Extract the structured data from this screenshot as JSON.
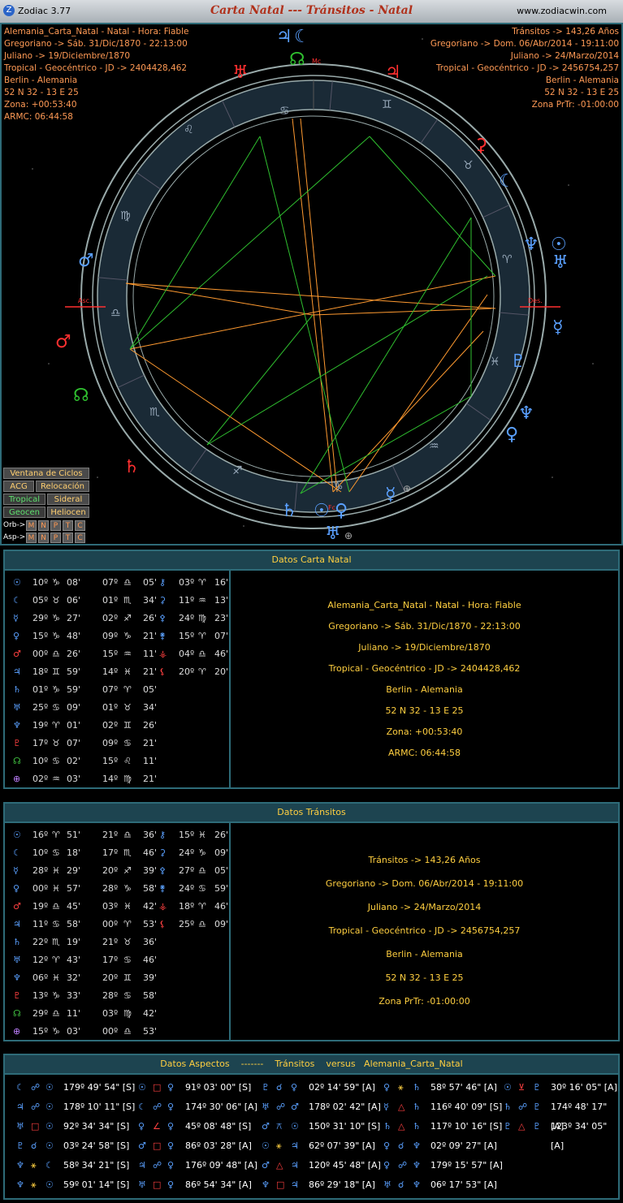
{
  "titlebar": {
    "app": "Zodiac 3.77",
    "title": "Carta Natal --- Tránsitos - Natal",
    "web": "www.zodiacwin.com"
  },
  "natal_info": [
    "Alemania_Carta_Natal - Natal - Hora: Fiable",
    "Gregoriano -> Sáb. 31/Dic/1870 - 22:13:00",
    "Juliano -> 19/Diciembre/1870",
    "Tropical - Geocéntrico - JD -> 2404428,462",
    "Berlin - Alemania",
    "52 N 32 - 13 E 25",
    "Zona: +00:53:40",
    "ARMC: 06:44:58"
  ],
  "transit_info": [
    "Tránsitos -> 143,26 Años",
    "Gregoriano -> Dom. 06/Abr/2014 - 19:11:00",
    "Juliano -> 24/Marzo/2014",
    "Tropical - Geocéntrico - JD -> 2456754,257",
    "Berlin - Alemania",
    "52 N 32 - 13 E 25",
    "Zona PrTr: -01:00:00"
  ],
  "wheel_labels": {
    "asc": "Asc.",
    "des": "Des.",
    "mc": "Mc",
    "fc": "Fc"
  },
  "buttons": {
    "ciclos": "Ventana de Ciclos",
    "acg": "ACG",
    "relocacion": "Relocación",
    "tropical": "Tropical",
    "sideral": "Sideral",
    "geocen": "Geocen",
    "heliocen": "Heliocen",
    "orb": "Orb->",
    "asp": "Asp->",
    "letters": [
      "M",
      "N",
      "P",
      "T",
      "C"
    ]
  },
  "natal_panel": {
    "header": "Datos Carta Natal",
    "rows": [
      [
        "☉",
        "10º",
        "♑",
        "08'",
        "07º",
        "♎",
        "05'",
        "⚷",
        "03º",
        "♈",
        "16'"
      ],
      [
        "☾",
        "05º",
        "♉",
        "06'",
        "01º",
        "♏",
        "34'",
        "⚳",
        "11º",
        "♒",
        "13'"
      ],
      [
        "☿",
        "29º",
        "♑",
        "27'",
        "02º",
        "♐",
        "26'",
        "⚴",
        "24º",
        "♍",
        "23'"
      ],
      [
        "♀",
        "15º",
        "♑",
        "48'",
        "09º",
        "♑",
        "21'",
        "⚵",
        "15º",
        "♈",
        "07'"
      ],
      [
        "♂",
        "00º",
        "♎",
        "26'",
        "15º",
        "♒",
        "11'",
        "⚶",
        "04º",
        "♎",
        "46'"
      ],
      [
        "♃",
        "18º",
        "♊",
        "59'",
        "14º",
        "♓",
        "21'",
        "⚸",
        "20º",
        "♈",
        "20'"
      ],
      [
        "♄",
        "01º",
        "♑",
        "59'",
        "07º",
        "♈",
        "05'",
        "",
        "",
        "",
        ""
      ],
      [
        "♅",
        "25º",
        "♋",
        "09'",
        "01º",
        "♉",
        "34'",
        "",
        "",
        "",
        ""
      ],
      [
        "♆",
        "19º",
        "♈",
        "01'",
        "02º",
        "♊",
        "26'",
        "",
        "",
        "",
        ""
      ],
      [
        "♇",
        "17º",
        "♉",
        "07'",
        "09º",
        "♋",
        "21'",
        "",
        "",
        "",
        ""
      ],
      [
        "☊",
        "10º",
        "♋",
        "02'",
        "15º",
        "♌",
        "11'",
        "",
        "",
        "",
        ""
      ],
      [
        "⊕",
        "02º",
        "♒",
        "03'",
        "14º",
        "♍",
        "21'",
        "",
        "",
        "",
        ""
      ]
    ],
    "info": [
      "Alemania_Carta_Natal - Natal - Hora: Fiable",
      "Gregoriano -> Sáb. 31/Dic/1870 - 22:13:00",
      "Juliano -> 19/Diciembre/1870",
      "Tropical - Geocéntrico - JD -> 2404428,462",
      "Berlin - Alemania",
      "52 N 32 - 13 E 25",
      "Zona: +00:53:40",
      "ARMC: 06:44:58"
    ]
  },
  "transit_panel": {
    "header": "Datos Tránsitos",
    "rows": [
      [
        "☉",
        "16º",
        "♈",
        "51'",
        "21º",
        "♎",
        "36'",
        "⚷",
        "15º",
        "♓",
        "26'"
      ],
      [
        "☾",
        "10º",
        "♋",
        "18'",
        "17º",
        "♏",
        "46'",
        "⚳",
        "24º",
        "♑",
        "09'"
      ],
      [
        "☿",
        "28º",
        "♓",
        "29'",
        "20º",
        "♐",
        "39'",
        "⚴",
        "27º",
        "♎",
        "05'"
      ],
      [
        "♀",
        "00º",
        "♓",
        "57'",
        "28º",
        "♑",
        "58'",
        "⚵",
        "24º",
        "♋",
        "59'"
      ],
      [
        "♂",
        "19º",
        "♎",
        "45'",
        "03º",
        "♓",
        "42'",
        "⚶",
        "18º",
        "♈",
        "46'"
      ],
      [
        "♃",
        "11º",
        "♋",
        "58'",
        "00º",
        "♈",
        "53'",
        "⚸",
        "25º",
        "♎",
        "09'"
      ],
      [
        "♄",
        "22º",
        "♏",
        "19'",
        "21º",
        "♉",
        "36'",
        "",
        "",
        "",
        ""
      ],
      [
        "♅",
        "12º",
        "♈",
        "43'",
        "17º",
        "♋",
        "46'",
        "",
        "",
        "",
        ""
      ],
      [
        "♆",
        "06º",
        "♓",
        "32'",
        "20º",
        "♊",
        "39'",
        "",
        "",
        "",
        ""
      ],
      [
        "♇",
        "13º",
        "♑",
        "33'",
        "28º",
        "♋",
        "58'",
        "",
        "",
        "",
        ""
      ],
      [
        "☊",
        "29º",
        "♎",
        "11'",
        "03º",
        "♍",
        "42'",
        "",
        "",
        "",
        ""
      ],
      [
        "⊕",
        "15º",
        "♑",
        "03'",
        "00º",
        "♎",
        "53'",
        "",
        "",
        "",
        ""
      ]
    ],
    "info": [
      "Tránsitos -> 143,26 Años",
      "Gregoriano -> Dom. 06/Abr/2014 - 19:11:00",
      "Juliano -> 24/Marzo/2014",
      "Tropical - Geocéntrico - JD -> 2456754,257",
      "Berlin - Alemania",
      "52 N 32 - 13 E 25",
      "Zona PrTr: -01:00:00"
    ]
  },
  "aspect_panel": {
    "header": [
      "Datos Aspectos",
      "-------",
      "Tránsitos",
      "versus",
      "Alemania_Carta_Natal"
    ],
    "cols": [
      [
        [
          "☾",
          "☍",
          "☉",
          "179º 49' 54\" [S]"
        ],
        [
          "♃",
          "☍",
          "☉",
          "178º 10' 11\" [S]"
        ],
        [
          "♅",
          "□",
          "☉",
          "92º 34' 34\" [S]"
        ],
        [
          "♇",
          "☌",
          "☉",
          "03º 24' 58\" [S]"
        ],
        [
          "♆",
          "⚹",
          "☾",
          "58º 34' 21\" [S]"
        ],
        [
          "♆",
          "⚹",
          "☉",
          "59º 01' 14\" [S]"
        ]
      ],
      [
        [
          "☉",
          "□",
          "♀",
          "91º 03' 00\" [S]"
        ],
        [
          "☾",
          "☍",
          "♀",
          "174º 30' 06\" [A]"
        ],
        [
          "♀",
          "∠",
          "♀",
          "45º 08' 48\" [S]"
        ],
        [
          "♂",
          "□",
          "♀",
          "86º 03' 28\" [A]"
        ],
        [
          "♃",
          "☍",
          "♀",
          "176º 09' 48\" [A]"
        ],
        [
          "♅",
          "□",
          "♀",
          "86º 54' 34\" [A]"
        ]
      ],
      [
        [
          "♇",
          "☌",
          "♀",
          "02º 14' 59\" [A]"
        ],
        [
          "♅",
          "☍",
          "♂",
          "178º 02' 42\" [A]"
        ],
        [
          "♂",
          "⚻",
          "☉",
          "150º 31' 10\" [S]"
        ],
        [
          "☉",
          "⚹",
          "♃",
          "62º 07' 39\" [A]"
        ],
        [
          "♂",
          "△",
          "♃",
          "120º 45' 48\" [A]"
        ],
        [
          "♆",
          "□",
          "♃",
          "86º 29' 18\" [A]"
        ]
      ],
      [
        [
          "♀",
          "⚹",
          "♄",
          "58º 57' 46\" [A]"
        ],
        [
          "☿",
          "△",
          "♄",
          "116º 40' 09\" [S]"
        ],
        [
          "♄",
          "△",
          "♄",
          "117º 10' 16\" [S]"
        ],
        [
          "♀",
          "☌",
          "♆",
          "02º 09' 27\" [A]"
        ],
        [
          "♀",
          "☍",
          "♆",
          "179º 15' 57\" [A]"
        ],
        [
          "♅",
          "☌",
          "♆",
          "06º 17' 53\" [A]"
        ]
      ],
      [
        [
          "☉",
          "⊻",
          "♇",
          "30º 16' 05\" [A]"
        ],
        [
          "♄",
          "☍",
          "♇",
          "174º 48' 17\" [A]"
        ],
        [
          "♇",
          "△",
          "♇",
          "123º 34' 05\" [A]"
        ]
      ]
    ]
  },
  "colors": {
    "sun": "#5aa0ff",
    "moon": "#5aa0ff",
    "mercury": "#5aa0ff",
    "venus": "#5aa0ff",
    "mars": "#ff4040",
    "jupiter": "#5aa0ff",
    "saturn": "#5aa0ff",
    "uranus": "#5aa0ff",
    "neptune": "#5aa0ff",
    "pluto": "#ff4040",
    "node": "#40c040",
    "transit_red": "#ff3030",
    "aspect_orange": "#ff9a30",
    "aspect_green": "#2fbf2f"
  }
}
